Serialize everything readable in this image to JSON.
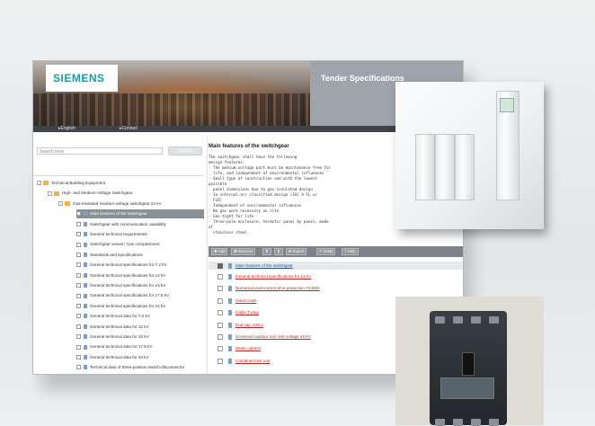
{
  "banner": {
    "logo": "SIEMENS",
    "title": "Tender Specifications"
  },
  "nav": {
    "links": [
      "English",
      "Contact"
    ]
  },
  "search": {
    "placeholder": "Search here",
    "button": "Search"
  },
  "tree": [
    {
      "label": "Technical Building Equipment",
      "level": 0,
      "icon": "folder-root-icon"
    },
    {
      "label": "High- and Medium-Voltage Switchgear",
      "level": 1,
      "icon": "folder-icon"
    },
    {
      "label": "Gas-insulated medium-voltage switchgear 24 kV",
      "level": 2,
      "icon": "folder-icon"
    },
    {
      "label": "Main features of the switchgear",
      "level": 3,
      "icon": "document-icon",
      "selected": true
    },
    {
      "label": "Switchgear with communication capability",
      "level": 3,
      "icon": "document-icon"
    },
    {
      "label": "General technical requirements",
      "level": 3,
      "icon": "document-icon"
    },
    {
      "label": "Switchgear vessel / Gas compartment",
      "level": 3,
      "icon": "document-icon"
    },
    {
      "label": "Standards and specifications",
      "level": 3,
      "icon": "document-icon"
    },
    {
      "label": "General technical specifications for 7.2 kV",
      "level": 3,
      "icon": "document-icon"
    },
    {
      "label": "General technical specifications for 12 kV",
      "level": 3,
      "icon": "document-icon"
    },
    {
      "label": "General technical specifications for 15 kV",
      "level": 3,
      "icon": "document-icon"
    },
    {
      "label": "General technical specifications for 17.5 kV",
      "level": 3,
      "icon": "document-icon"
    },
    {
      "label": "General technical specifications for 24 kV",
      "level": 3,
      "icon": "document-icon"
    },
    {
      "label": "General technical data for 7.2 kV",
      "level": 3,
      "icon": "document-icon"
    },
    {
      "label": "General technical data for 12 kV",
      "level": 3,
      "icon": "document-icon"
    },
    {
      "label": "General technical data for 15 kV",
      "level": 3,
      "icon": "document-icon"
    },
    {
      "label": "General technical data for 17.5 kV",
      "level": 3,
      "icon": "document-icon"
    },
    {
      "label": "General technical data for 24 kV",
      "level": 3,
      "icon": "document-icon"
    },
    {
      "label": "Technical data of three-position switch-disconnector",
      "level": 3,
      "icon": "document-icon"
    }
  ],
  "detail": {
    "heading": "Main features of the switchgear",
    "text_lines": [
      "The switchgear shall have the following",
      "design features:",
      "- The medium-voltage part must be maintenance-free for",
      "  life, and independent of environmental influences",
      "- Small type of construction and with the lowest",
      "possible",
      "  panel dimensions due to gas-insulated design",
      "- In internal-arc classified design (IAC A FL or",
      "  FLR)",
      "- Independent of environmental influences",
      "- No gas work necessary on site",
      "- Gas-tight for life",
      "- Three-pole enclosure, hermetic panel by panel, made",
      "of",
      "  stainless steel"
    ]
  },
  "toolbar": {
    "add": "Add",
    "remove": "Remove",
    "export": "Export",
    "undo": "Undo",
    "help": "Help"
  },
  "table": {
    "header": "Main features of the switchgear",
    "rows": [
      "General technical specifications for 12 kV",
      "Numerical overcurrent-time protection 7SJ600",
      "Hand crank",
      "Cable T-plug",
      "End cap, 630 A",
      "Screened outdoor insl. test voltage 40 kV",
      "Water cabinet",
      "Combined test unit"
    ]
  },
  "colors": {
    "brand": "#1b9aa6",
    "selected": "#8a9097",
    "link": "#c0281f",
    "toolbar": "#7d8388"
  }
}
